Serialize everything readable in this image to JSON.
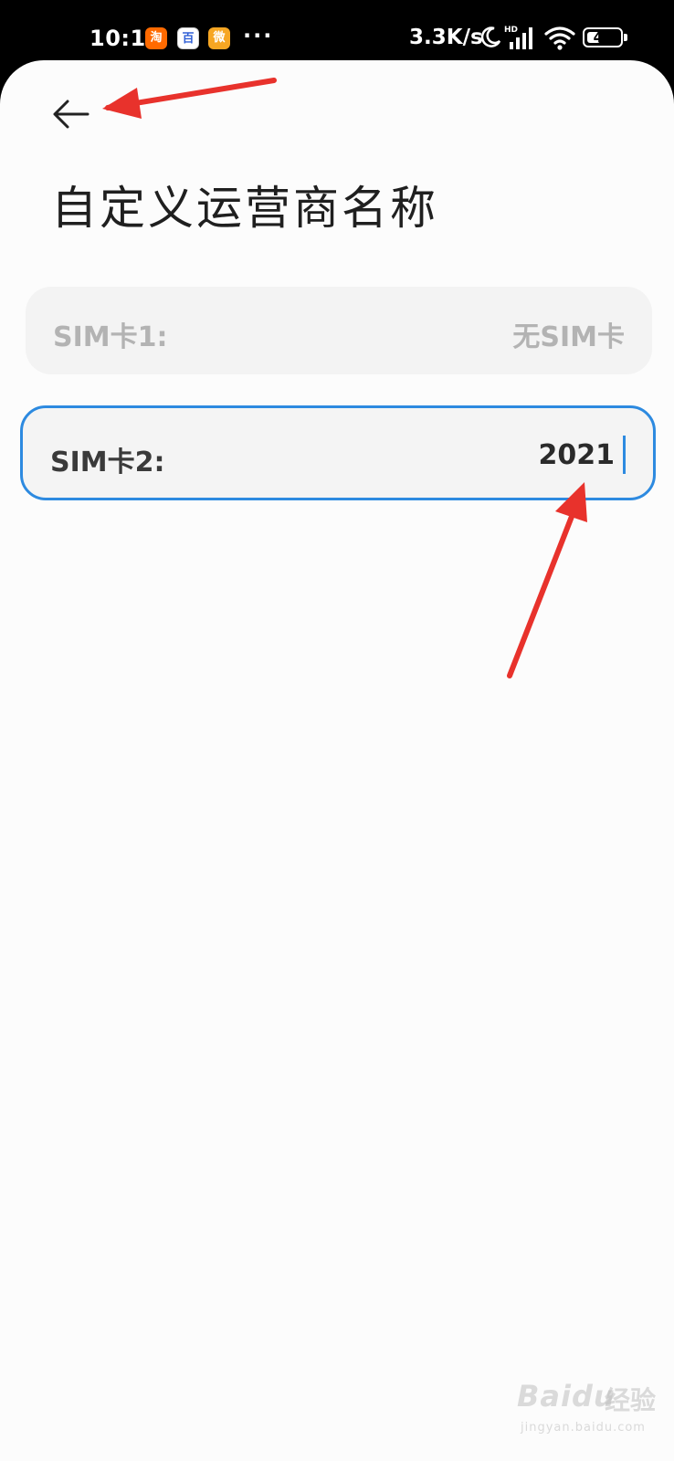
{
  "status_bar": {
    "time": "10:16",
    "app_icons": [
      "taobao-icon",
      "baidu-icon",
      "weibo-icon"
    ],
    "taobao_glyph": "淘",
    "baidu_glyph": "百",
    "weibo_glyph": "微",
    "more": "···",
    "net_speed": "3.3K/s",
    "battery_level": "42",
    "battery_fraction": 0.42
  },
  "header": {
    "title": "自定义运营商名称"
  },
  "sim_cards": [
    {
      "label": "SIM卡1:",
      "value": "无SIM卡",
      "enabled": false
    },
    {
      "label": "SIM卡2:",
      "value": "2021",
      "enabled": true,
      "focused": true
    }
  ],
  "colors": {
    "focus_border": "#2d8ae0",
    "annotation_arrow": "#e8322c"
  },
  "watermark": {
    "brand": "Baidu",
    "cn": "经验",
    "url": "jingyan.baidu.com"
  }
}
